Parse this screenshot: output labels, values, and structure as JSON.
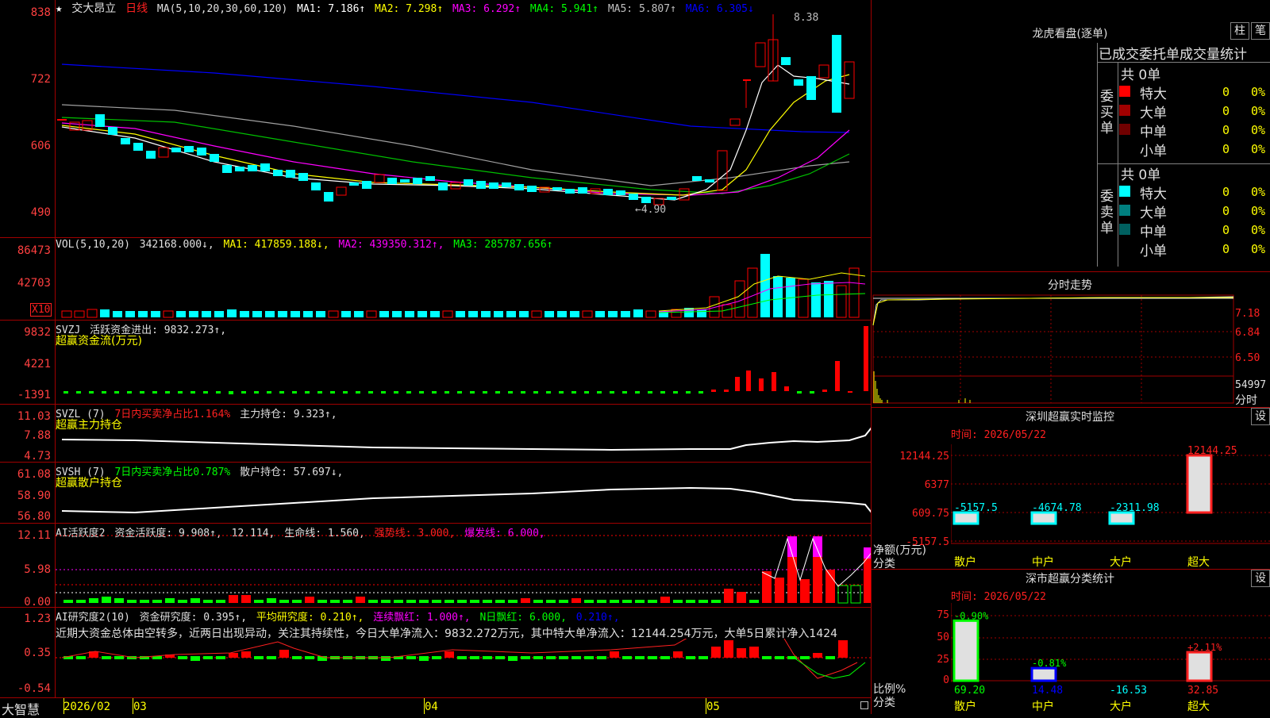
{
  "left": {
    "star": "★",
    "stock_name": "交大昂立",
    "period": "日线",
    "ma_params": "MA(5,10,20,30,60,120)",
    "ma_items": [
      {
        "label": "MA1: 7.186↑",
        "color": "#ffffff"
      },
      {
        "label": "MA2: 7.298↑",
        "color": "#ffff00"
      },
      {
        "label": "MA3: 6.292↑",
        "color": "#ff00ff"
      },
      {
        "label": "MA4: 5.941↑",
        "color": "#00ff00"
      },
      {
        "label": "MA5: 5.807↑",
        "color": "#c0c0c0"
      },
      {
        "label": "MA6: 6.305↓",
        "color": "#0000ff"
      }
    ],
    "price_axis": [
      "838",
      "722",
      "606",
      "490"
    ],
    "high_mark": "8.38",
    "low_mark": "←4.90",
    "vol": {
      "label": "VOL(5,10,20)",
      "value": "342168.000↓,",
      "ma1": "MA1: 417859.188↓,",
      "ma2": "MA2: 439350.312↑,",
      "ma3": "MA3: 285787.656↑",
      "axis": [
        "86473",
        "42703"
      ],
      "unit": "X10"
    },
    "svzj": {
      "label": "SVZJ",
      "text": "活跃资金进出: 9832.273↑,",
      "title": "超赢资金流(万元)",
      "axis": [
        "9832",
        "4221",
        "-1391"
      ]
    },
    "svzl": {
      "label": "SVZL (7)",
      "pct": "7日内买卖净占比1.164%",
      "text": "主力持仓: 9.323↑,",
      "title": "超赢主力持仓",
      "axis": [
        "11.03",
        "7.88",
        "4.73"
      ]
    },
    "svsh": {
      "label": "SVSH (7)",
      "pct": "7日内买卖净占比0.787%",
      "text": "散户持仓: 57.697↓,",
      "title": "超赢散户持仓",
      "axis": [
        "61.08",
        "58.90",
        "56.80"
      ]
    },
    "ai": {
      "label": "AI活跃度2",
      "t1": "资金活跃度: 9.908↑,",
      "t2": "12.114,",
      "t3": "生命线: 1.560,",
      "t4": "强势线: 3.000,",
      "t5": "爆发线: 6.000,",
      "axis": [
        "12.11",
        "5.98",
        "0.00"
      ]
    },
    "research": {
      "label": "AI研究度2(10)",
      "t1": "资金研究度: 0.395↑,",
      "t2": "平均研究度: 0.210↑,",
      "t3": "连续飘红: 1.000↑,",
      "t4": "N日飘红: 6.000,",
      "t5": "0.210↑,",
      "comment": "近期大资金总体由空转多，近两日出现异动，关注其持续性，今日大单净流入：9832.272万元，其中特大单净流入：12144.254万元，大单5日累计净入1424",
      "axis": [
        "1.23",
        "0.35",
        "-0.54"
      ]
    },
    "footer": {
      "brand": "大智慧",
      "d1": "2026/02",
      "d2": "03",
      "d3": "04",
      "d4": "05"
    }
  },
  "right": {
    "dragon": {
      "title": "龙虎看盘(逐单)",
      "btn1": "柱",
      "btn2": "笔",
      "tabs": "已成交委托单成交量统计",
      "buy_label": "委买单",
      "sell_label": "委卖单",
      "buy_total": "共 0单",
      "sell_total": "共 0单",
      "rows_buy": [
        {
          "name": "特大",
          "v": "0",
          "p": "0%",
          "color": "#ff0000"
        },
        {
          "name": "大单",
          "v": "0",
          "p": "0%",
          "color": "#a00000"
        },
        {
          "name": "中单",
          "v": "0",
          "p": "0%",
          "color": "#700000"
        },
        {
          "name": "小单",
          "v": "0",
          "p": "0%",
          "color": "#000000"
        }
      ],
      "rows_sell": [
        {
          "name": "特大",
          "v": "0",
          "p": "0%",
          "color": "#00ffff"
        },
        {
          "name": "大单",
          "v": "0",
          "p": "0%",
          "color": "#008080"
        },
        {
          "name": "中单",
          "v": "0",
          "p": "0%",
          "color": "#006060"
        },
        {
          "name": "小单",
          "v": "0",
          "p": "0%",
          "color": "#000000"
        }
      ]
    },
    "intraday": {
      "title": "分时走势",
      "axis": [
        "7.18",
        "6.84",
        "6.50"
      ],
      "vol_axis": "54997",
      "unit": "分时"
    },
    "sz_monitor": {
      "title": "深圳超赢实时监控",
      "set": "设",
      "time": "时间: 2026/05/22",
      "axis": [
        "12144.25",
        "6377",
        "609.75",
        "-5157.5"
      ],
      "net_label": "净额(万元)",
      "cat_label": "分类",
      "bars": [
        {
          "cat": "散户",
          "value": -5157.5,
          "label": "-5157.5"
        },
        {
          "cat": "中户",
          "value": -4674.78,
          "label": "-4674.78"
        },
        {
          "cat": "大户",
          "value": -2311.98,
          "label": "-2311.98"
        },
        {
          "cat": "超大",
          "value": 12144.25,
          "label": "12144.25"
        }
      ]
    },
    "sz_stats": {
      "title": "深市超赢分类统计",
      "set": "设",
      "time": "时间: 2026/05/22",
      "axis": [
        "75",
        "50",
        "25",
        "0"
      ],
      "ratio_label": "比例%",
      "cat_label": "分类",
      "bars": [
        {
          "cat": "散户",
          "value": 69.2,
          "pct": "-0.90%",
          "label": "69.20"
        },
        {
          "cat": "中户",
          "value": 14.48,
          "pct": "-0.81%",
          "label": "14.48"
        },
        {
          "cat": "大户",
          "value": -16.53,
          "pct": "",
          "label": "-16.53"
        },
        {
          "cat": "超大",
          "value": 32.85,
          "pct": "+2.11%",
          "label": "32.85"
        }
      ]
    }
  }
}
